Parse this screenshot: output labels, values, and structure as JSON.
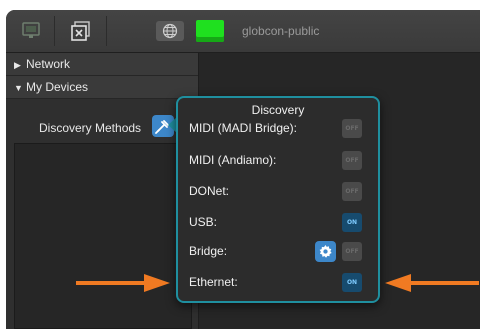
{
  "toolbar": {
    "network_name": "globcon-public",
    "network_color": "#1fe01f"
  },
  "sidebar": {
    "items": [
      {
        "label": "Network",
        "expanded": false
      },
      {
        "label": "My Devices",
        "expanded": true
      }
    ],
    "discovery_methods_label": "Discovery Methods"
  },
  "discovery": {
    "title": "Discovery",
    "methods": [
      {
        "label": "MIDI (MADI Bridge):",
        "state": "OFF"
      },
      {
        "label": "MIDI (Andiamo):",
        "state": "OFF"
      },
      {
        "label": "DONet:",
        "state": "OFF"
      },
      {
        "label": "USB:",
        "state": "ON"
      },
      {
        "label": "Bridge:",
        "state": "OFF",
        "has_settings": true
      },
      {
        "label": "Ethernet:",
        "state": "ON"
      }
    ]
  },
  "annotations": {
    "arrow_color": "#f07a22"
  }
}
